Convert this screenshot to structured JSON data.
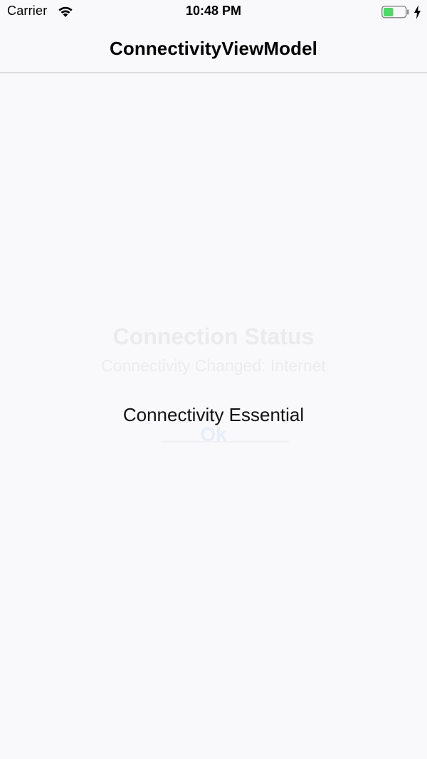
{
  "status_bar": {
    "carrier": "Carrier",
    "time": "10:48 PM",
    "wifi_icon": "wifi-icon",
    "battery_icon": "battery-icon",
    "charging_icon": "charging-bolt-icon",
    "battery_level_fraction": 0.45,
    "battery_color": "#4cd964"
  },
  "nav": {
    "title": "ConnectivityViewModel"
  },
  "alert": {
    "title": "Connection Status",
    "message": "Connectivity Changed: Internet",
    "ok_label": "Ok"
  },
  "main": {
    "label": "Connectivity Essential"
  },
  "colors": {
    "background": "#f9f8fa",
    "nav_border": "#b2b2b4"
  }
}
